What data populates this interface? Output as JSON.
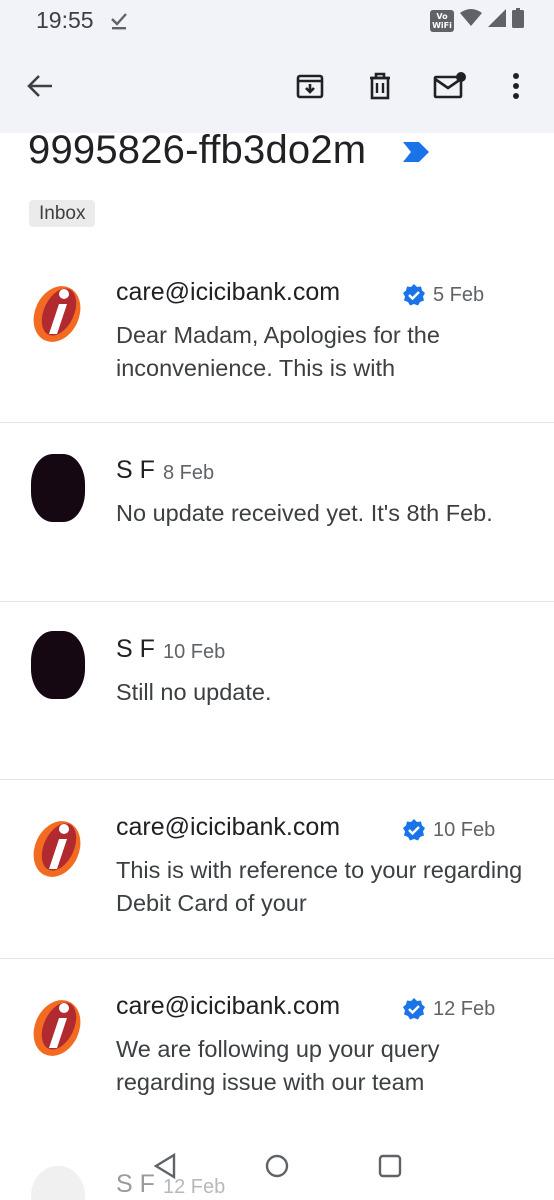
{
  "status_bar": {
    "time": "19:55",
    "vowifi_top": "Vo",
    "vowifi_bottom": "WiFi"
  },
  "toolbar": {
    "back_icon": "arrow-back-icon",
    "archive_icon": "archive-icon",
    "delete_icon": "trash-icon",
    "mark_unread_icon": "mail-unread-icon",
    "more_icon": "more-vert-icon"
  },
  "thread": {
    "subject": "9995826-ffb3do2m",
    "label": "Inbox"
  },
  "messages": [
    {
      "sender": "care@icicibank.com",
      "verified": true,
      "date": "5 Feb",
      "snippet": "Dear Madam, Apologies for the inconvenience. This is with"
    },
    {
      "sender": "S F",
      "verified": false,
      "date": "8 Feb",
      "snippet": "No update received yet. It's 8th Feb."
    },
    {
      "sender": "S F",
      "verified": false,
      "date": "10 Feb",
      "snippet": "Still no update."
    },
    {
      "sender": "care@icicibank.com",
      "verified": true,
      "date": "10 Feb",
      "snippet": "This is with reference to your regarding Debit Card of your"
    },
    {
      "sender": "care@icicibank.com",
      "verified": true,
      "date": "12 Feb",
      "snippet": "We are following up your query regarding issue with our team"
    },
    {
      "sender": "S F",
      "verified": false,
      "date": "12 Feb",
      "snippet": ""
    }
  ],
  "colors": {
    "brand_orange": "#f26b21",
    "brand_red": "#b02a30",
    "verified_blue": "#1a73e8",
    "topbar_bg": "#f1f3f8"
  }
}
